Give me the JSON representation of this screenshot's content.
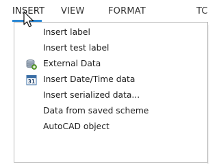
{
  "menubar": {
    "tabs": [
      {
        "label": "INSERT",
        "active": true
      },
      {
        "label": "VIEW",
        "active": false
      },
      {
        "label": "FORMAT",
        "active": false
      },
      {
        "label": "TC",
        "active": false
      }
    ]
  },
  "insert_menu": {
    "items": [
      {
        "label": "Insert label",
        "icon": null
      },
      {
        "label": "Insert test label",
        "icon": null
      },
      {
        "label": "External Data",
        "icon": "database-add-icon"
      },
      {
        "label": "Insert Date/Time data",
        "icon": "calendar-icon",
        "icon_text": "31"
      },
      {
        "label": "Insert serialized data...",
        "icon": null
      },
      {
        "label": "Data from saved scheme",
        "icon": null
      },
      {
        "label": "AutoCAD object",
        "icon": null
      }
    ]
  },
  "colors": {
    "accent": "#2a87d4",
    "text": "#1e1e1e",
    "menu_border": "#b9b9b9"
  }
}
